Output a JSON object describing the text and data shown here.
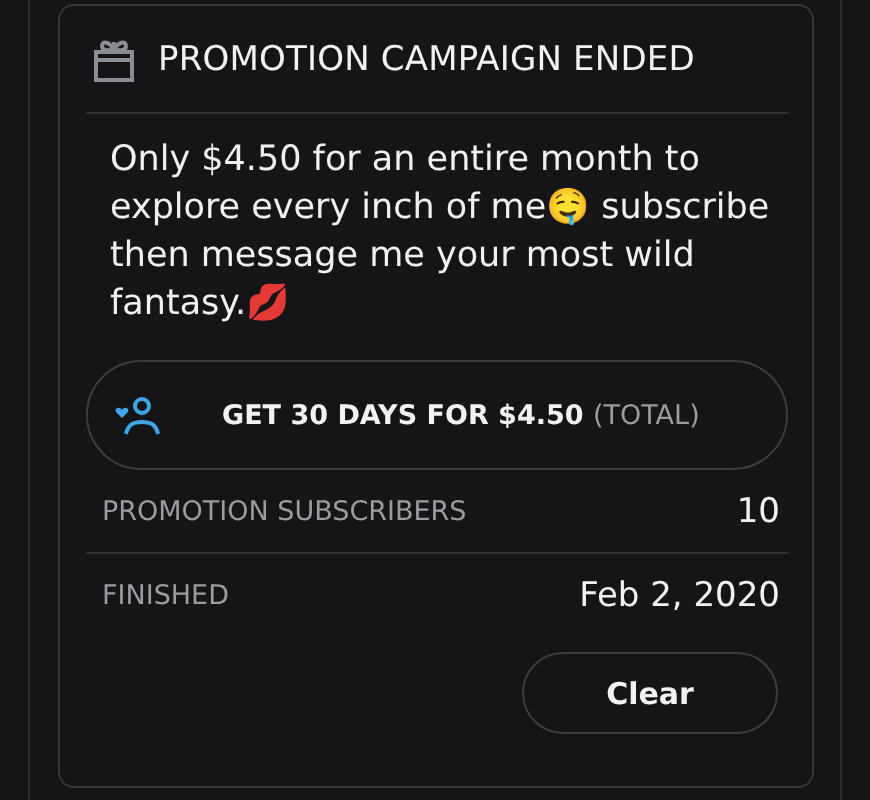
{
  "card": {
    "title": "PROMOTION CAMPAIGN ENDED",
    "message": "Only $4.50 for an entire month to explore every inch of me🤤 subscribe then message me your most wild fantasy.💋",
    "offer_button": {
      "label": "GET 30 DAYS FOR $4.50",
      "suffix": "(TOTAL)"
    },
    "stats": [
      {
        "label": "PROMOTION SUBSCRIBERS",
        "value": "10"
      },
      {
        "label": "FINISHED",
        "value": "Feb 2, 2020"
      }
    ],
    "clear_button": {
      "label": "Clear"
    }
  }
}
